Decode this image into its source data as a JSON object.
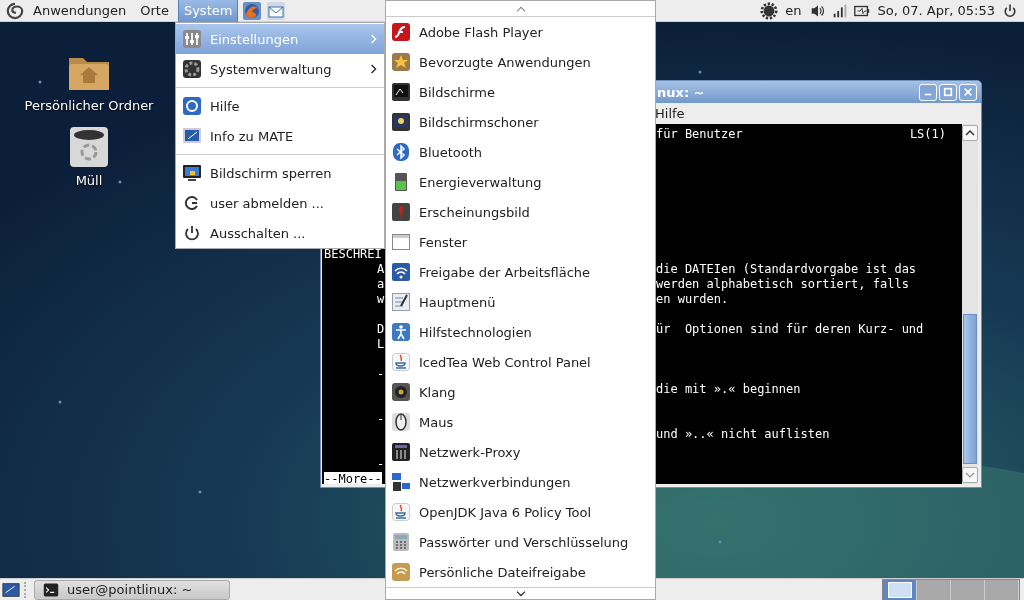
{
  "top_panel": {
    "menus": [
      {
        "label": "Anwendungen",
        "selected": false
      },
      {
        "label": "Orte",
        "selected": false
      },
      {
        "label": "System",
        "selected": true
      }
    ],
    "keyboard_layout": "en",
    "clock": "So, 07. Apr, 05:53"
  },
  "desktop_icons": [
    {
      "label": "Persönlicher Ordner",
      "kind": "folder"
    },
    {
      "label": "Müll",
      "kind": "trash"
    }
  ],
  "terminal": {
    "title": "nux: ~",
    "menu": "Hilfe",
    "lines": [
      {
        "kind": "text",
        "right": "für Benutzer",
        "end": "LS(1)"
      },
      {
        "kind": "blank"
      },
      {
        "kind": "blank"
      },
      {
        "kind": "blank"
      },
      {
        "kind": "blank"
      },
      {
        "kind": "blank"
      },
      {
        "kind": "blank"
      },
      {
        "kind": "blank"
      },
      {
        "kind": "text",
        "heading": "BESCHREI"
      },
      {
        "kind": "text",
        "left": "A",
        "right": "die DATEIen (Standardvorgabe ist das"
      },
      {
        "kind": "text",
        "left": "a",
        "right": "werden alphabetisch sortiert, falls"
      },
      {
        "kind": "text",
        "left": "w",
        "right": "en wurden."
      },
      {
        "kind": "blank"
      },
      {
        "kind": "text",
        "left": "D",
        "right": "ür  Optionen sind für deren Kurz- und"
      },
      {
        "kind": "text",
        "left": "L"
      },
      {
        "kind": "blank"
      },
      {
        "kind": "text",
        "left": "-"
      },
      {
        "kind": "text",
        "right": "die mit ».« beginnen"
      },
      {
        "kind": "blank"
      },
      {
        "kind": "text",
        "left": "-"
      },
      {
        "kind": "text",
        "right": "und »..« nicht auflisten"
      },
      {
        "kind": "blank"
      },
      {
        "kind": "text",
        "left": "-"
      },
      {
        "kind": "prompt",
        "heading": "--More--"
      }
    ]
  },
  "system_menu": [
    {
      "kind": "submenu",
      "label": "Einstellungen",
      "selected": true
    },
    {
      "kind": "submenu",
      "label": "Systemverwaltung",
      "selected": false
    },
    {
      "kind": "separator"
    },
    {
      "kind": "item",
      "label": "Hilfe",
      "selected": false
    },
    {
      "kind": "item",
      "label": "Info zu MATE",
      "selected": false
    },
    {
      "kind": "separator"
    },
    {
      "kind": "item",
      "label": "Bildschirm sperren",
      "selected": false
    },
    {
      "kind": "item",
      "label": "user abmelden ...",
      "selected": false
    },
    {
      "kind": "item",
      "label": "Ausschalten ...",
      "selected": false
    }
  ],
  "settings_menu": [
    "Adobe Flash Player",
    "Bevorzugte Anwendungen",
    "Bildschirme",
    "Bildschirmschoner",
    "Bluetooth",
    "Energieverwaltung",
    "Erscheinungsbild",
    "Fenster",
    "Freigabe der Arbeitsfläche",
    "Hauptmenü",
    "Hilfstechnologien",
    "IcedTea Web Control Panel",
    "Klang",
    "Maus",
    "Netzwerk-Proxy",
    "Netzwerkverbindungen",
    "OpenJDK Java 6 Policy Tool",
    "Passwörter und Verschlüsselung",
    "Persönliche Dateifreigabe"
  ],
  "bottom_panel": {
    "task": "user@pointlinux: ~",
    "workspaces": [
      {
        "selected": true
      },
      {
        "selected": false
      },
      {
        "selected": false
      },
      {
        "selected": false
      }
    ]
  }
}
